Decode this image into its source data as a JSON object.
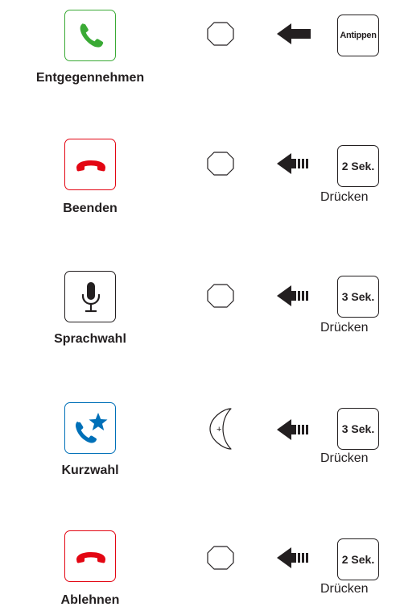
{
  "rows": [
    {
      "label": "Entgegennehmen",
      "icon": "phone-answer-icon",
      "icon_border_color": "#3aaa35",
      "icon_color": "#3aaa35",
      "button_shape": "rounded-octagon-button-icon",
      "arrow": "solid-arrow-left-icon",
      "key_label": "Antippen",
      "note": ""
    },
    {
      "label": "Beenden",
      "icon": "phone-hangup-icon",
      "icon_border_color": "#e30613",
      "icon_color": "#e30613",
      "button_shape": "rounded-octagon-button-icon",
      "arrow": "hold-arrow-left-icon",
      "key_label": "2 Sek.",
      "note": "Drücken"
    },
    {
      "label": "Sprachwahl",
      "icon": "microphone-icon",
      "icon_border_color": "#231f20",
      "icon_color": "#231f20",
      "button_shape": "rounded-octagon-button-icon",
      "arrow": "hold-arrow-left-icon",
      "key_label": "3 Sek.",
      "note": "Drücken"
    },
    {
      "label": "Kurzwahl",
      "icon": "phone-star-icon",
      "icon_border_color": "#0070b8",
      "icon_color": "#0070b8",
      "button_shape": "crescent-plus-button-icon",
      "arrow": "hold-arrow-left-icon",
      "key_label": "3 Sek.",
      "note": "Drücken"
    },
    {
      "label": "Ablehnen",
      "icon": "phone-hangup-icon",
      "icon_border_color": "#e30613",
      "icon_color": "#e30613",
      "button_shape": "rounded-octagon-button-icon",
      "arrow": "hold-arrow-left-icon",
      "key_label": "2 Sek.",
      "note": "Drücken"
    }
  ],
  "plus_symbol": "+"
}
